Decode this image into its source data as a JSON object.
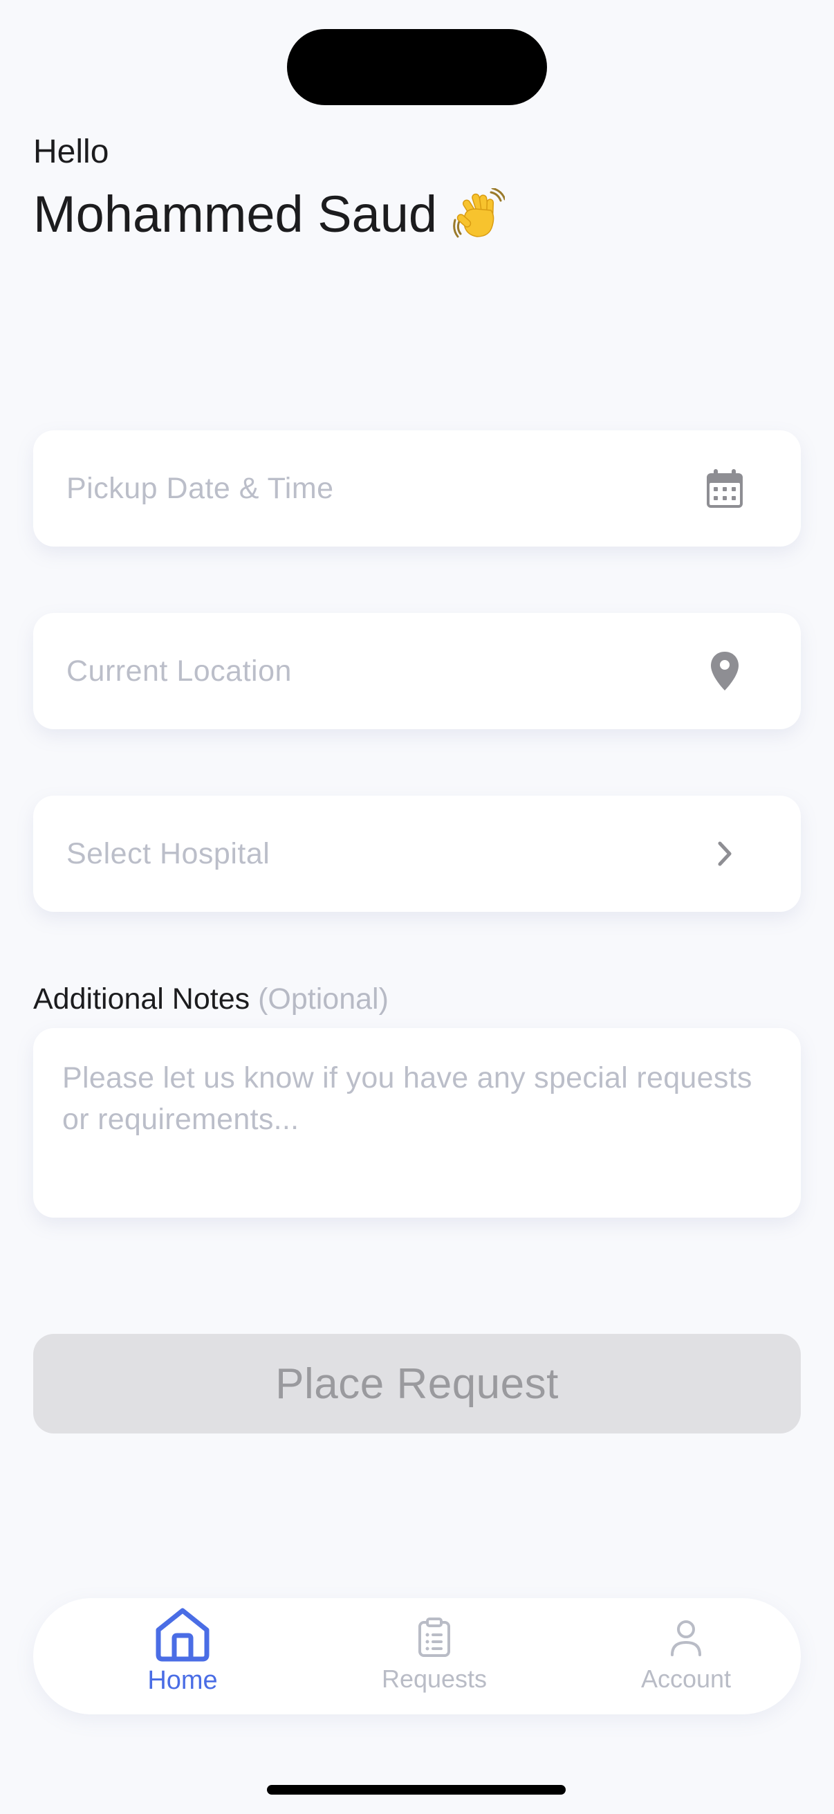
{
  "greeting": {
    "hello": "Hello",
    "name": "Mohammed Saud",
    "wave_icon": "waving-hand-icon"
  },
  "form": {
    "pickup": {
      "label": "Pickup Date & Time",
      "icon": "calendar-icon"
    },
    "location": {
      "label": "Current Location",
      "icon": "location-pin-icon"
    },
    "hospital": {
      "label": "Select Hospital",
      "icon": "chevron-right-icon"
    },
    "notes": {
      "label": "Additional Notes",
      "optional": "(Optional)",
      "placeholder": "Please let us know if you have any special requests or requirements...",
      "value": ""
    },
    "submit_label": "Place Request",
    "submit_enabled": false
  },
  "tabbar": {
    "active": "home",
    "tabs": [
      {
        "id": "home",
        "label": "Home",
        "icon": "home-icon"
      },
      {
        "id": "requests",
        "label": "Requests",
        "icon": "clipboard-icon"
      },
      {
        "id": "account",
        "label": "Account",
        "icon": "person-icon"
      }
    ]
  },
  "colors": {
    "background": "#f8f9fc",
    "accent": "#4a6de5",
    "placeholder": "#bbbec9",
    "disabled_button": "#e0e0e3",
    "disabled_text": "#9a9a9e"
  }
}
